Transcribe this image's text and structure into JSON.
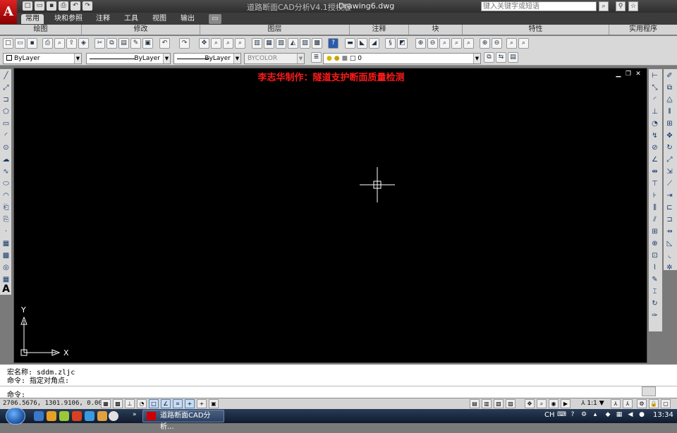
{
  "app": {
    "logo_letter": "A",
    "title": "道路断面CAD分析V4.1授权版",
    "document": "Drawing6.dwg",
    "search_placeholder": "键入关键字或短语"
  },
  "ribbon": {
    "tabs": [
      {
        "label": "常用",
        "active": true
      },
      {
        "label": "块和参照",
        "active": false
      },
      {
        "label": "注释",
        "active": false
      },
      {
        "label": "工具",
        "active": false
      },
      {
        "label": "视图",
        "active": false
      },
      {
        "label": "输出",
        "active": false
      }
    ],
    "panels": [
      "绘图",
      "修改",
      "图层",
      "注释",
      "块",
      "特性",
      "实用程序"
    ]
  },
  "properties": {
    "color": "ByLayer",
    "linetype": "ByLayer",
    "lineweight": "ByLayer",
    "plotstyle": "BYCOLOR",
    "layer": "0"
  },
  "canvas": {
    "title": "李志华制作：隧道支护断面质量检测",
    "background": "#000000",
    "title_color": "#ff1a1a",
    "ucs_x": "X",
    "ucs_y": "Y"
  },
  "command": {
    "line1": "宏名称: sddm.zljc",
    "line2": "命令: 指定对角点:",
    "prompt": "命令:"
  },
  "status": {
    "coords": "2706.5676,  1301.9106, 0.0000",
    "annotation_scale": "1:1"
  },
  "taskbar": {
    "task_label": "道路断面CAD分析...",
    "language": "CH",
    "clock": "13:34"
  }
}
